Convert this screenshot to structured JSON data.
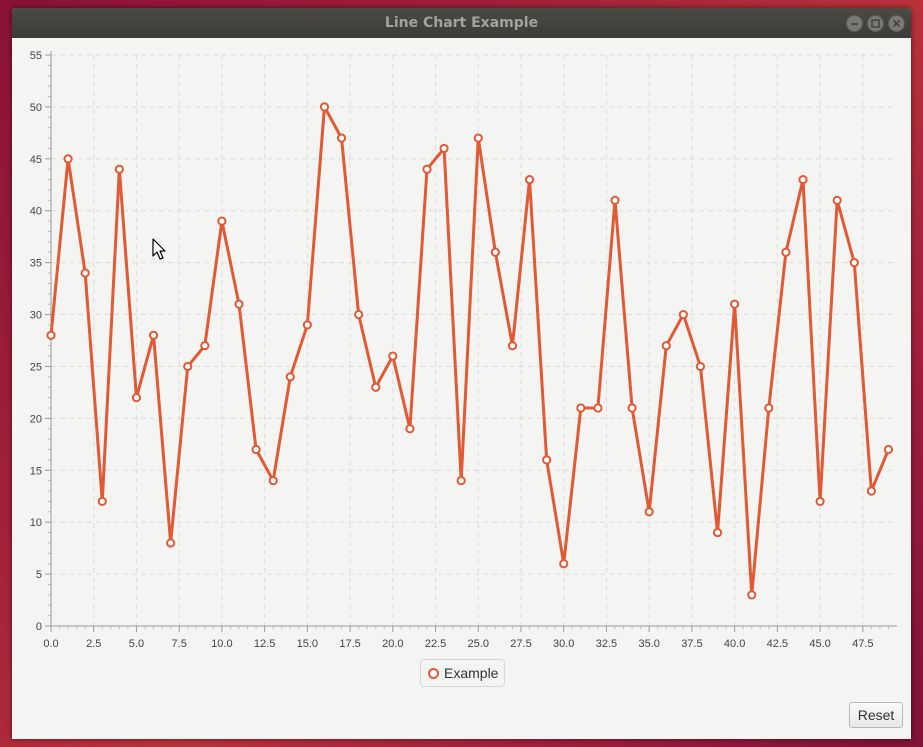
{
  "window": {
    "title": "Line Chart Example"
  },
  "legend": {
    "label": "Example"
  },
  "buttons": {
    "reset_label": "Reset"
  },
  "colors": {
    "series": "#e05a35",
    "grid": "#dcdcda",
    "background": "#f4f4f2"
  },
  "icons": [
    "minimize-icon",
    "maximize-icon",
    "close-icon",
    "cursor-icon"
  ],
  "chart_data": {
    "type": "line",
    "title": "",
    "xlabel": "",
    "ylabel": "",
    "xlim": [
      0,
      49.5
    ],
    "ylim": [
      0,
      55
    ],
    "x_ticks": [
      "0.0",
      "2.5",
      "5.0",
      "7.5",
      "10.0",
      "12.5",
      "15.0",
      "17.5",
      "20.0",
      "22.5",
      "25.0",
      "27.5",
      "30.0",
      "32.5",
      "35.0",
      "37.5",
      "40.0",
      "42.5",
      "45.0",
      "47.5"
    ],
    "y_ticks": [
      "0",
      "5",
      "10",
      "15",
      "20",
      "25",
      "30",
      "35",
      "40",
      "45",
      "50",
      "55"
    ],
    "grid": true,
    "legend_position": "bottom-center",
    "series": [
      {
        "name": "Example",
        "x": [
          0,
          1,
          2,
          3,
          4,
          5,
          6,
          7,
          8,
          9,
          10,
          11,
          12,
          13,
          14,
          15,
          16,
          17,
          18,
          19,
          20,
          21,
          22,
          23,
          24,
          25,
          26,
          27,
          28,
          29,
          30,
          31,
          32,
          33,
          34,
          35,
          36,
          37,
          38,
          39,
          40,
          41,
          42,
          43,
          44,
          45,
          46,
          47,
          48,
          49
        ],
        "y": [
          28,
          45,
          34,
          12,
          44,
          22,
          28,
          8,
          25,
          27,
          39,
          31,
          17,
          14,
          24,
          29,
          50,
          47,
          30,
          23,
          26,
          19,
          44,
          46,
          14,
          47,
          36,
          27,
          43,
          16,
          6,
          21,
          21,
          41,
          21,
          11,
          27,
          30,
          25,
          9,
          31,
          3,
          21,
          36,
          43,
          12,
          41,
          35,
          13,
          17
        ]
      }
    ]
  }
}
